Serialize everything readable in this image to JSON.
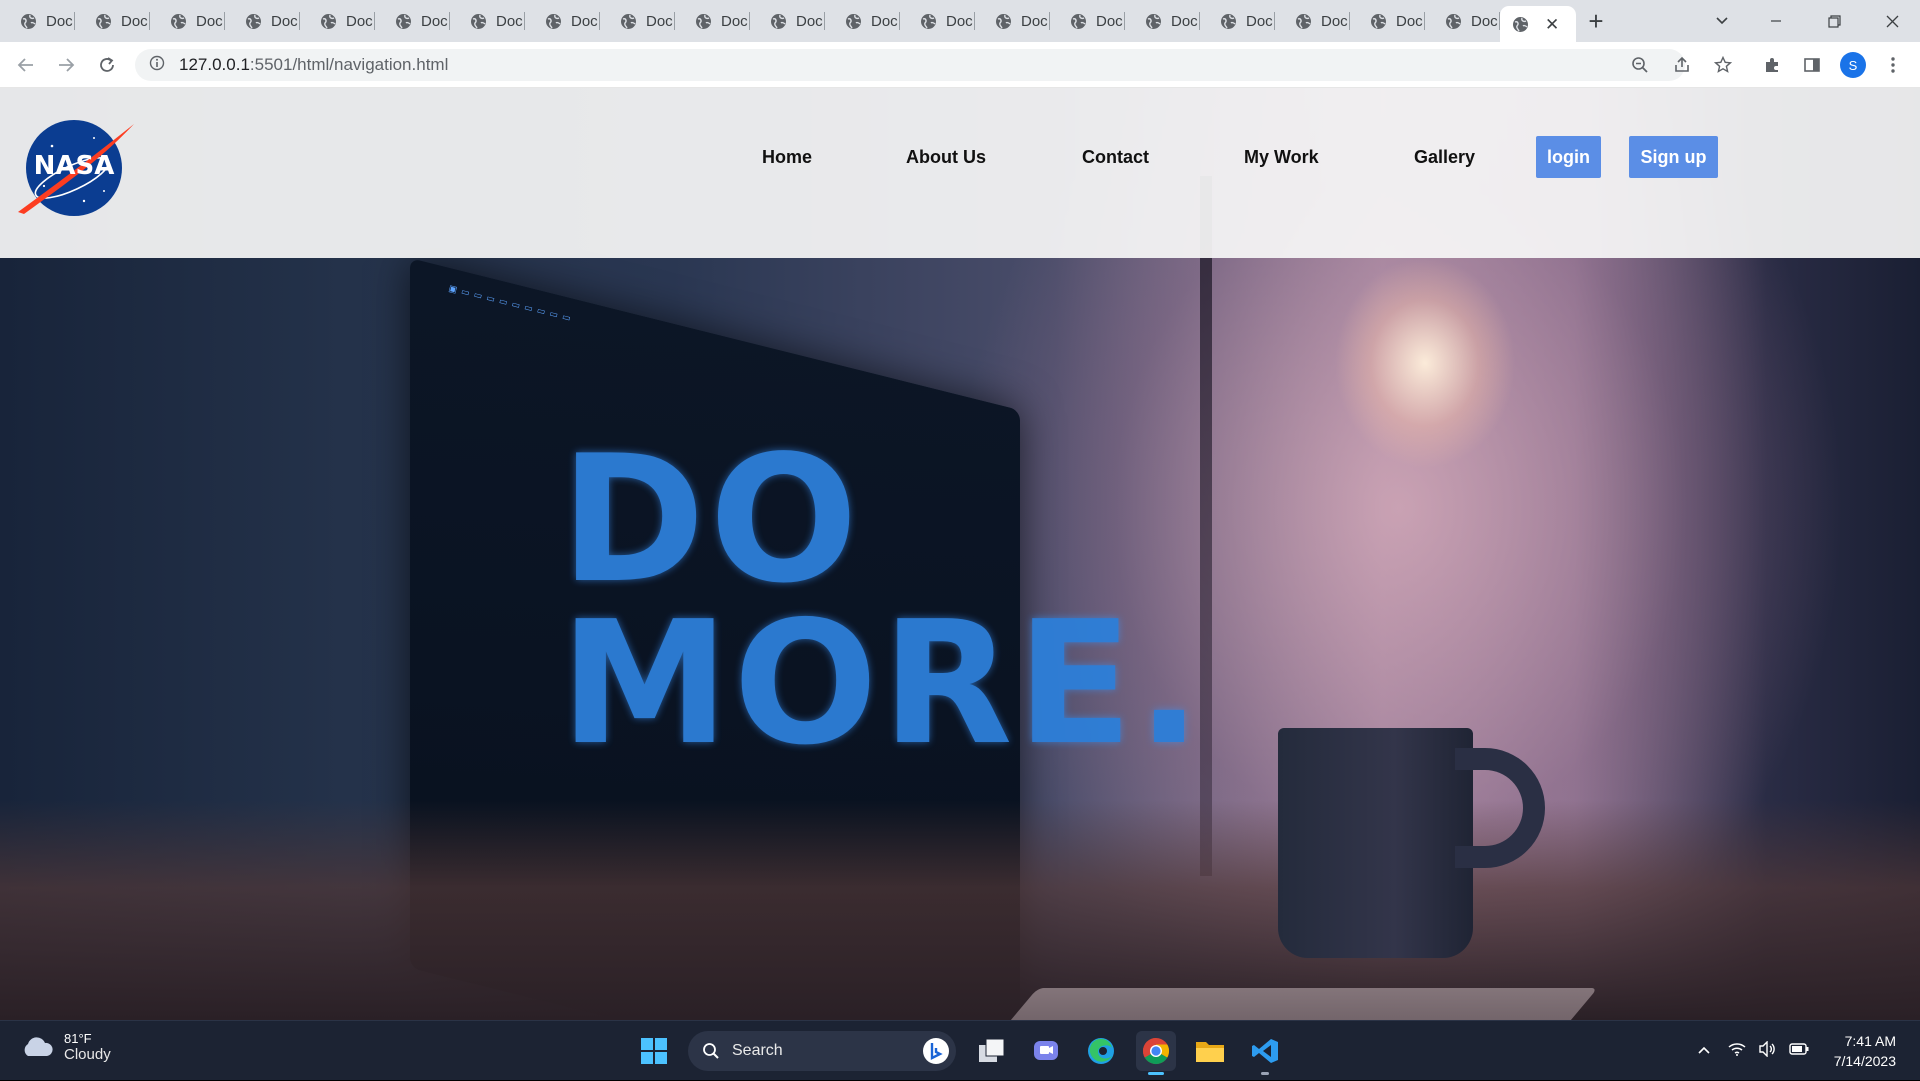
{
  "browser": {
    "tab_title": "Doc",
    "tab_count": 20,
    "url_host": "127.0.0.1",
    "url_rest": ":5501/html/navigation.html",
    "profile_initial": "S"
  },
  "site": {
    "logo_text": "NASA",
    "nav": {
      "home": "Home",
      "about": "About Us",
      "contact": "Contact",
      "work": "My Work",
      "gallery": "Gallery"
    },
    "login_label": "login",
    "signup_label": "Sign up",
    "hero_line1": "DO",
    "hero_line2": "MORE."
  },
  "taskbar": {
    "weather_temp": "81°F",
    "weather_desc": "Cloudy",
    "search_label": "Search",
    "time": "7:41 AM",
    "date": "7/14/2023"
  },
  "colors": {
    "button": "#5b8ee6",
    "header_bg": "#f6f6f6",
    "taskbar_bg": "#1c2333",
    "hero_text": "#2d7fd9"
  }
}
